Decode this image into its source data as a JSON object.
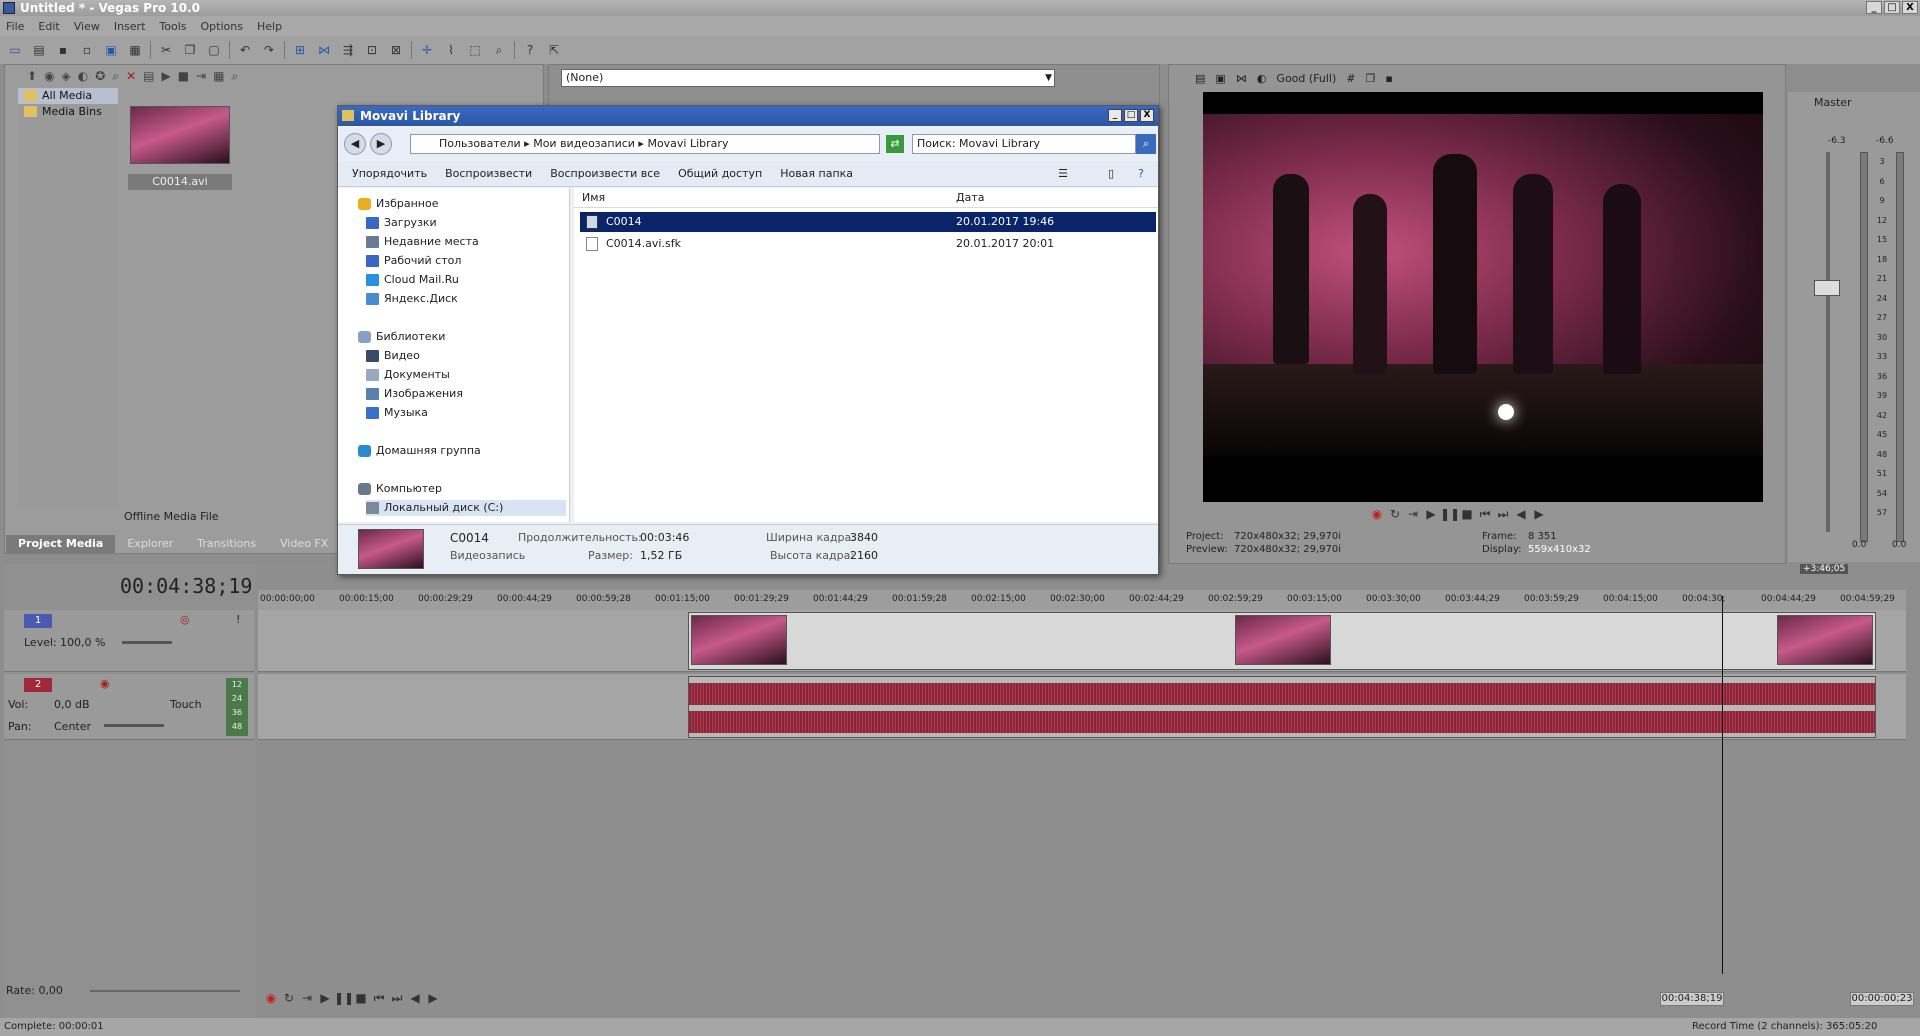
{
  "app": {
    "title": "Untitled * - Vegas Pro 10.0",
    "window_controls": [
      "_",
      "□",
      "X"
    ]
  },
  "menu": [
    "File",
    "Edit",
    "View",
    "Insert",
    "Tools",
    "Options",
    "Help"
  ],
  "project_media": {
    "tree": [
      "All Media",
      "Media Bins"
    ],
    "thumb_label": "C0014.avi",
    "offline_label": "Offline Media File",
    "tabs": [
      "Project Media",
      "Explorer",
      "Transitions",
      "Video FX"
    ]
  },
  "trimmer": {
    "dropdown": "(None)"
  },
  "preview": {
    "quality": "Good (Full)",
    "project_label": "Project:",
    "project_val": "720x480x32; 29,970i",
    "preview_label": "Preview:",
    "preview_val": "720x480x32; 29,970i",
    "frame_label": "Frame:",
    "frame_val": "8 351",
    "display_label": "Display:",
    "display_val": "559x410x32"
  },
  "master": {
    "label": "Master",
    "values": [
      "-6.3",
      "-6.6"
    ],
    "scale": [
      "3",
      "6",
      "9",
      "12",
      "15",
      "18",
      "21",
      "24",
      "27",
      "30",
      "33",
      "36",
      "39",
      "42",
      "45",
      "48",
      "51",
      "54",
      "57"
    ],
    "bottom": [
      "0.0",
      "0.0"
    ]
  },
  "dialog": {
    "title": "Movavi Library",
    "breadcrumb": [
      "Пользователи",
      "Мои видеозаписи",
      "Movavi Library"
    ],
    "search_placeholder": "Поиск: Movavi Library",
    "commands": [
      "Упорядочить",
      "Воспроизвести",
      "Воспроизвести все",
      "Общий доступ",
      "Новая папка"
    ],
    "nav": [
      {
        "label": "Избранное",
        "kind": "group",
        "color": "#e8b020"
      },
      {
        "label": "Загрузки",
        "kind": "item",
        "color": "#3a66c8"
      },
      {
        "label": "Недавние места",
        "kind": "item",
        "color": "#6a7a9a"
      },
      {
        "label": "Рабочий стол",
        "kind": "item",
        "color": "#3a66c8"
      },
      {
        "label": "Cloud Mail.Ru",
        "kind": "item",
        "color": "#2a90e0"
      },
      {
        "label": "Яндекс.Диск",
        "kind": "item",
        "color": "#4a8ad0"
      },
      {
        "label": "Библиотеки",
        "kind": "group",
        "color": "#8aa0c0"
      },
      {
        "label": "Видео",
        "kind": "item",
        "color": "#3a4a6a"
      },
      {
        "label": "Документы",
        "kind": "item",
        "color": "#9aa8c0"
      },
      {
        "label": "Изображения",
        "kind": "item",
        "color": "#5a80b0"
      },
      {
        "label": "Музыка",
        "kind": "item",
        "color": "#3a70c8"
      },
      {
        "label": "Домашняя группа",
        "kind": "group",
        "color": "#2a8ad0"
      },
      {
        "label": "Компьютер",
        "kind": "group",
        "color": "#6a7a8a"
      },
      {
        "label": "Локальный диск (C:)",
        "kind": "item",
        "color": "#7a8a9a"
      }
    ],
    "columns": [
      "Имя",
      "Дата"
    ],
    "files": [
      {
        "name": "C0014",
        "date": "20.01.2017 19:46"
      },
      {
        "name": "C0014.avi.sfk",
        "date": "20.01.2017 20:01"
      }
    ],
    "details": {
      "name": "C0014",
      "type": "Видеозапись",
      "duration_label": "Продолжительность:",
      "duration": "00:03:46",
      "size_label": "Размер:",
      "size": "1,52 ГБ",
      "width_label": "Ширина кадра:",
      "width": "3840",
      "height_label": "Высота кадра:",
      "height": "2160"
    }
  },
  "timeline": {
    "timecode": "00:04:38;19",
    "ruler": [
      "00:00:00;00",
      "00:00:15;00",
      "00:00:29;29",
      "00:00:44;29",
      "00:00:59;28",
      "00:01:15;00",
      "00:01:29;29",
      "00:01:44;29",
      "00:01:59;28",
      "00:02:15;00",
      "00:02:30;00",
      "00:02:44;29",
      "00:02:59;29",
      "00:03:15;00",
      "00:03:30;00",
      "00:03:44;29",
      "00:03:59;29",
      "00:04:15;00",
      "00:04:30;",
      "00:04:44;29",
      "00:04:59;29"
    ],
    "marker": "+3:46;05",
    "track1": {
      "num": "1",
      "level_label": "Level:",
      "level": "100,0 %"
    },
    "track2": {
      "num": "2",
      "vol_label": "Vol:",
      "vol": "0,0 dB",
      "pan_label": "Pan:",
      "pan": "Center",
      "automation": "Touch",
      "meter": [
        "12",
        "24",
        "36",
        "48"
      ]
    }
  },
  "bottom": {
    "rate_label": "Rate:",
    "rate": "0,00",
    "cursor_time": "00:04:38;19",
    "length_time": "00:00:00;23"
  },
  "status": {
    "complete": "Complete: 00:00:01",
    "record": "Record Time (2 channels): 365:05:20"
  }
}
